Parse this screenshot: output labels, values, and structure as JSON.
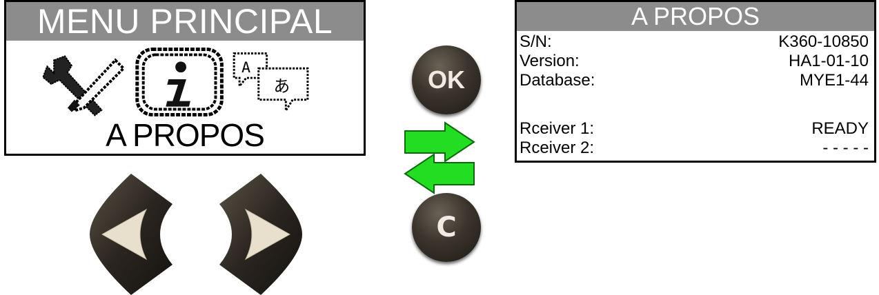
{
  "menu_screen": {
    "title": "MENU PRINCIPAL",
    "selected_label": "A PROPOS",
    "icons": [
      "settings-tools-icon",
      "info-icon",
      "language-icon"
    ]
  },
  "buttons": {
    "ok": "OK",
    "cancel": "C"
  },
  "info_screen": {
    "title": "A PROPOS",
    "rows": [
      {
        "label": "S/N:",
        "value": "K360-10850"
      },
      {
        "label": "Version:",
        "value": "HA1-01-10"
      },
      {
        "label": "Database:",
        "value": "MYE1-44"
      },
      {
        "label": "Rceiver 1:",
        "value": "READY"
      },
      {
        "label": "Rceiver 2:",
        "value": "- - - - -"
      }
    ]
  },
  "colors": {
    "title_bar": "#8c8c8c",
    "arrow_green": "#22dd22",
    "button_dark": "#2e2922",
    "nav_arrow_fill": "#e8e0cc"
  }
}
